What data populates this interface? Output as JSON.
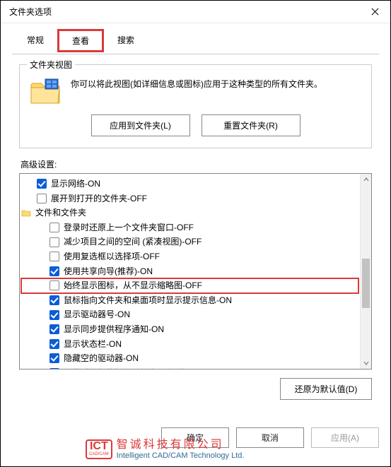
{
  "window": {
    "title": "文件夹选项"
  },
  "tabs": {
    "t0": "常规",
    "t1": "查看",
    "t2": "搜索"
  },
  "group": {
    "title": "文件夹视图",
    "desc": "你可以将此视图(如详细信息或图标)应用于这种类型的所有文件夹。",
    "apply_btn": "应用到文件夹(L)",
    "reset_btn": "重置文件夹(R)"
  },
  "adv": {
    "label": "高级设置:",
    "items": [
      {
        "text": "显示网络-ON",
        "checked": true
      },
      {
        "text": "展开到打开的文件夹-OFF",
        "checked": false
      },
      {
        "text": "文件和文件夹",
        "type": "folder"
      },
      {
        "text": "登录时还原上一个文件夹窗口-OFF",
        "checked": false
      },
      {
        "text": "减少项目之间的空间 (紧凑视图)-OFF",
        "checked": false
      },
      {
        "text": "使用复选框以选择项-OFF",
        "checked": false
      },
      {
        "text": "使用共享向导(推荐)-ON",
        "checked": true
      },
      {
        "text": "始终显示图标，从不显示缩略图-OFF",
        "checked": false,
        "highlight": true
      },
      {
        "text": "鼠标指向文件夹和桌面项时显示提示信息-ON",
        "checked": true
      },
      {
        "text": "显示驱动器号-ON",
        "checked": true
      },
      {
        "text": "显示同步提供程序通知-ON",
        "checked": true
      },
      {
        "text": "显示状态栏-ON",
        "checked": true
      },
      {
        "text": "隐藏空的驱动器-ON",
        "checked": true
      },
      {
        "text": "隐藏受保护的操作系统文件(推荐)-ON",
        "checked": true
      }
    ],
    "restore_btn": "还原为默认值(D)"
  },
  "footer": {
    "ok": "确定",
    "cancel": "取消",
    "apply": "应用(A)"
  },
  "watermark": {
    "logo_top": "ICT",
    "logo_bot": "CAD/CAM",
    "ch": "智诚科技有限公司",
    "en": "Intelligent CAD/CAM Technology Ltd."
  }
}
